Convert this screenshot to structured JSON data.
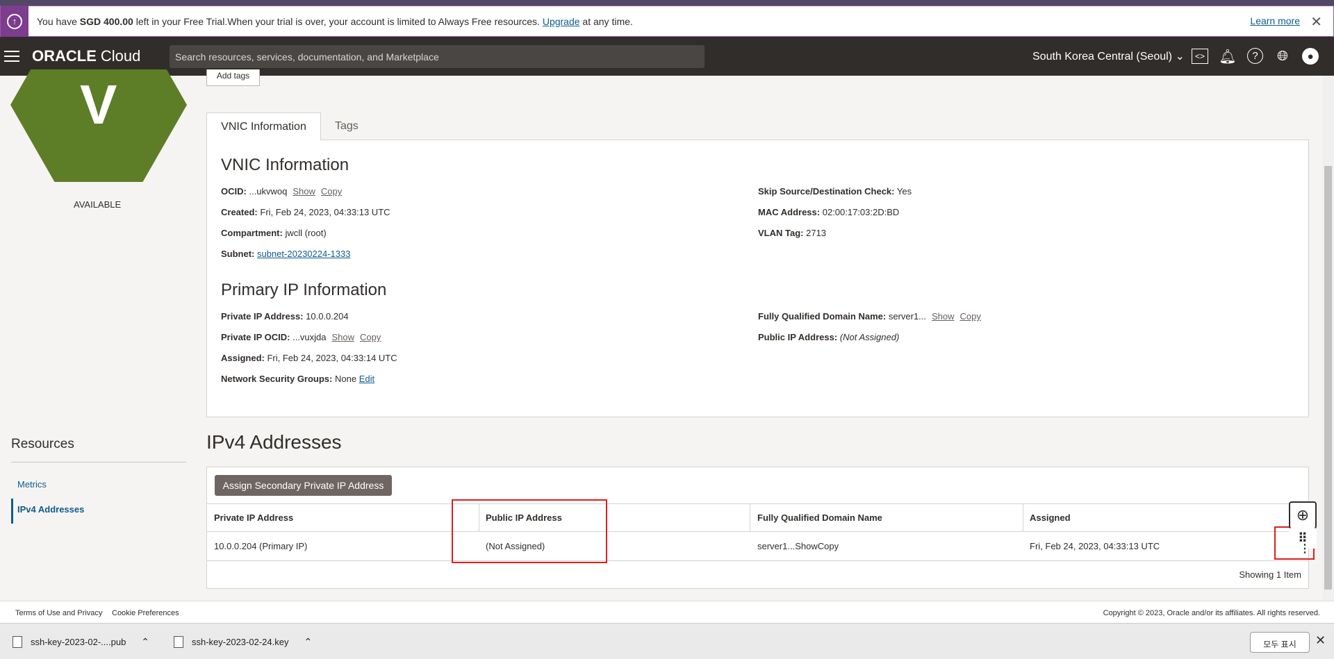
{
  "trial_banner": {
    "prefix": "You have ",
    "amount": "SGD 400.00",
    "middle": " left in your Free Trial.When your trial is over, your account is limited to Always Free resources. ",
    "upgrade": "Upgrade",
    "suffix": " at any time.",
    "learn_more": "Learn more"
  },
  "navbar": {
    "logo_brand": "ORACLE",
    "logo_product": "Cloud",
    "search_placeholder": "Search resources, services, documentation, and Marketplace",
    "region": "South Korea Central (Seoul)"
  },
  "resource": {
    "letter": "V",
    "status": "AVAILABLE",
    "add_tags": "Add tags"
  },
  "tabs": [
    {
      "label": "VNIC Information"
    },
    {
      "label": "Tags"
    }
  ],
  "vnic": {
    "heading": "VNIC Information",
    "ocid_label": "OCID:",
    "ocid_value": "...ukvwoq",
    "show": "Show",
    "copy": "Copy",
    "created_label": "Created:",
    "created_value": "Fri, Feb 24, 2023, 04:33:13 UTC",
    "compartment_label": "Compartment:",
    "compartment_value": "jwcll (root)",
    "subnet_label": "Subnet:",
    "subnet_value": "subnet-20230224-1333",
    "skip_label": "Skip Source/Destination Check:",
    "skip_value": "Yes",
    "mac_label": "MAC Address:",
    "mac_value": "02:00:17:03:2D:BD",
    "vlan_label": "VLAN Tag:",
    "vlan_value": "2713"
  },
  "primary_ip": {
    "heading": "Primary IP Information",
    "private_ip_label": "Private IP Address:",
    "private_ip_value": "10.0.0.204",
    "private_ocid_label": "Private IP OCID:",
    "private_ocid_value": "...vuxjda",
    "assigned_label": "Assigned:",
    "assigned_value": "Fri, Feb 24, 2023, 04:33:14 UTC",
    "nsg_label": "Network Security Groups:",
    "nsg_value": "None",
    "edit": "Edit",
    "fqdn_label": "Fully Qualified Domain Name:",
    "fqdn_value": "server1...",
    "public_ip_label": "Public IP Address:",
    "public_ip_value": "(Not Assigned)"
  },
  "resources": {
    "heading": "Resources",
    "items": [
      {
        "label": "Metrics"
      },
      {
        "label": "IPv4 Addresses"
      }
    ]
  },
  "ipv4": {
    "heading": "IPv4 Addresses",
    "assign_button": "Assign Secondary Private IP Address",
    "columns": [
      "Private IP Address",
      "Public IP Address",
      "Fully Qualified Domain Name",
      "Assigned"
    ],
    "rows": [
      {
        "private_ip": "10.0.0.204 (Primary IP)",
        "public_ip": "(Not Assigned)",
        "fqdn": "server1...",
        "assigned": "Fri, Feb 24, 2023, 04:33:13 UTC"
      }
    ],
    "showing": "Showing 1 Item"
  },
  "footer": {
    "terms": "Terms of Use and Privacy",
    "cookies": "Cookie Preferences",
    "copyright": "Copyright © 2023, Oracle and/or its affiliates. All rights reserved."
  },
  "downloads": {
    "items": [
      {
        "name": "ssh-key-2023-02-....pub"
      },
      {
        "name": "ssh-key-2023-02-24.key"
      }
    ],
    "show_all": "모두 표시"
  },
  "colors": {
    "accent": "#0d5c8e",
    "navbar": "#312d2a",
    "hexagon": "#5d7e26",
    "highlight": "#e01d1d",
    "trial_banner": "#7d3c8d"
  }
}
